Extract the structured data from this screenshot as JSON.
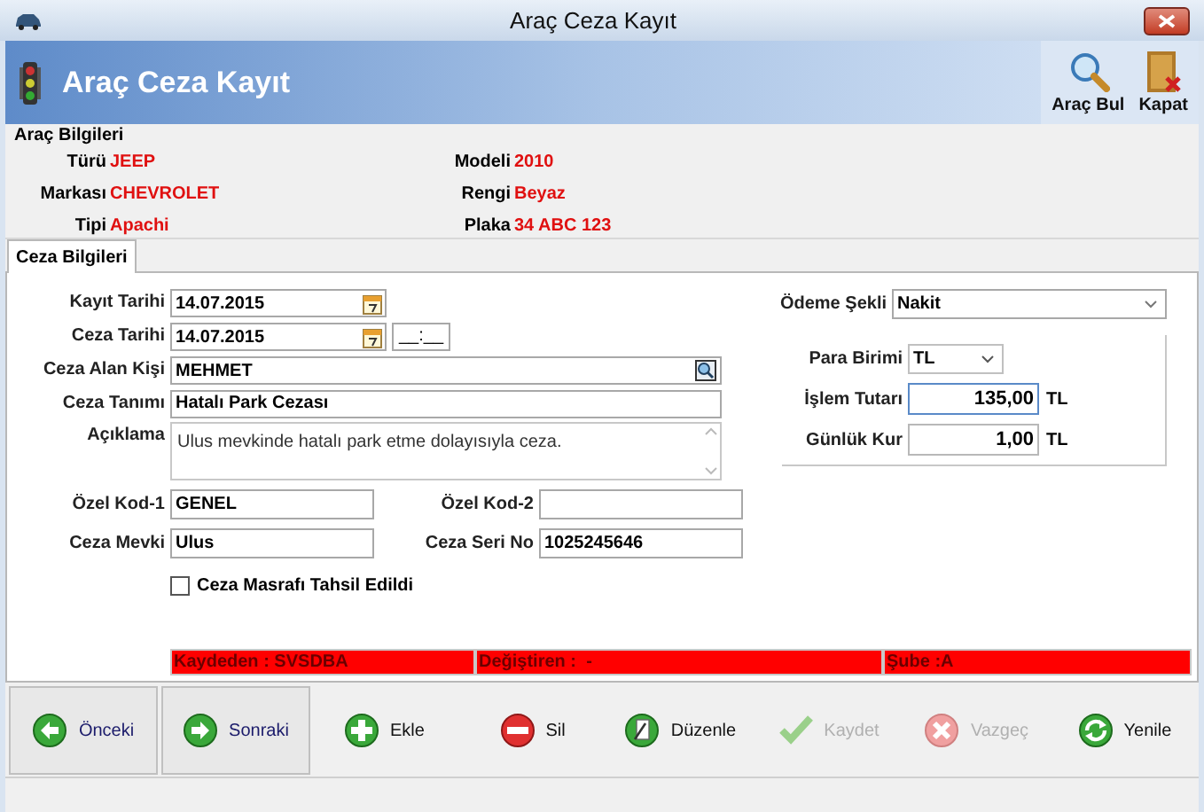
{
  "window": {
    "title": "Araç Ceza Kayıt"
  },
  "header": {
    "title": "Araç Ceza Kayıt",
    "actions": [
      {
        "label": "Araç Bul",
        "kind": "search"
      },
      {
        "label": "Kapat",
        "kind": "exit"
      }
    ]
  },
  "vehicle": {
    "title": "Araç Bilgileri",
    "rows": [
      [
        {
          "label": "Türü",
          "value": "JEEP"
        },
        {
          "label": "Modeli",
          "value": "2010"
        }
      ],
      [
        {
          "label": "Markası",
          "value": "CHEVROLET"
        },
        {
          "label": "Rengi",
          "value": "Beyaz"
        }
      ],
      [
        {
          "label": "Tipi",
          "value": "Apachi"
        },
        {
          "label": "Plaka",
          "value": "34 ABC 123"
        }
      ]
    ]
  },
  "tabs": [
    {
      "label": "Ceza Bilgileri",
      "selected": true
    }
  ],
  "fields": [
    {
      "kind": "date",
      "label": "Kayıt Tarihi",
      "value": "14.07.2015"
    },
    {
      "kind": "datetime",
      "label": "Ceza Tarihi",
      "value": "14.07.2015",
      "time": "__:__"
    },
    {
      "kind": "lookup",
      "label": "Ceza Alan Kişi",
      "value": "MEHMET"
    },
    {
      "kind": "text",
      "label": "Ceza Tanımı",
      "value": "Hatalı Park Cezası"
    },
    {
      "kind": "memo",
      "label": "Açıklama",
      "value": "Ulus mevkinde hatalı park etme dolayısıyla ceza."
    }
  ],
  "code_rows": [
    [
      {
        "label": "Özel Kod-1",
        "value": "GENEL"
      },
      {
        "label": "Özel Kod-2"
      }
    ],
    [
      {
        "label": "Ceza Mevki",
        "value": "Ulus"
      },
      {
        "label": "Ceza Seri No",
        "value": "1025245646"
      }
    ]
  ],
  "checkbox": {
    "label": "Ceza Masrafı Tahsil Edildi",
    "checked": false
  },
  "payment": {
    "label": "Ödeme Şekli",
    "value": "Nakit"
  },
  "currency": [
    {
      "kind": "select",
      "label": "Para Birimi",
      "value": "TL"
    },
    {
      "kind": "number",
      "label": "İşlem Tutarı",
      "value": "135,00",
      "unit": "TL",
      "focused": true
    },
    {
      "kind": "number",
      "label": "Günlük Kur",
      "value": "1,00",
      "unit": "TL",
      "focused": false
    }
  ],
  "audit": [
    "Kaydeden : SVSDBA",
    "Değiştiren :  -",
    "Şube :A"
  ],
  "toolbar": [
    {
      "kind": "prev",
      "label": "Önceki",
      "framed": true,
      "disabled": false
    },
    {
      "kind": "next",
      "label": "Sonraki",
      "framed": true,
      "disabled": false
    },
    {
      "kind": "add",
      "label": "Ekle",
      "framed": false,
      "disabled": false
    },
    {
      "kind": "delete",
      "label": "Sil",
      "framed": false,
      "disabled": false
    },
    {
      "kind": "edit",
      "label": "Düzenle",
      "framed": false,
      "disabled": false
    },
    {
      "kind": "save",
      "label": "Kaydet",
      "framed": false,
      "disabled": true
    },
    {
      "kind": "cancel",
      "label": "Vazgeç",
      "framed": false,
      "disabled": true
    },
    {
      "kind": "refresh",
      "label": "Yenile",
      "framed": false,
      "disabled": false
    }
  ]
}
